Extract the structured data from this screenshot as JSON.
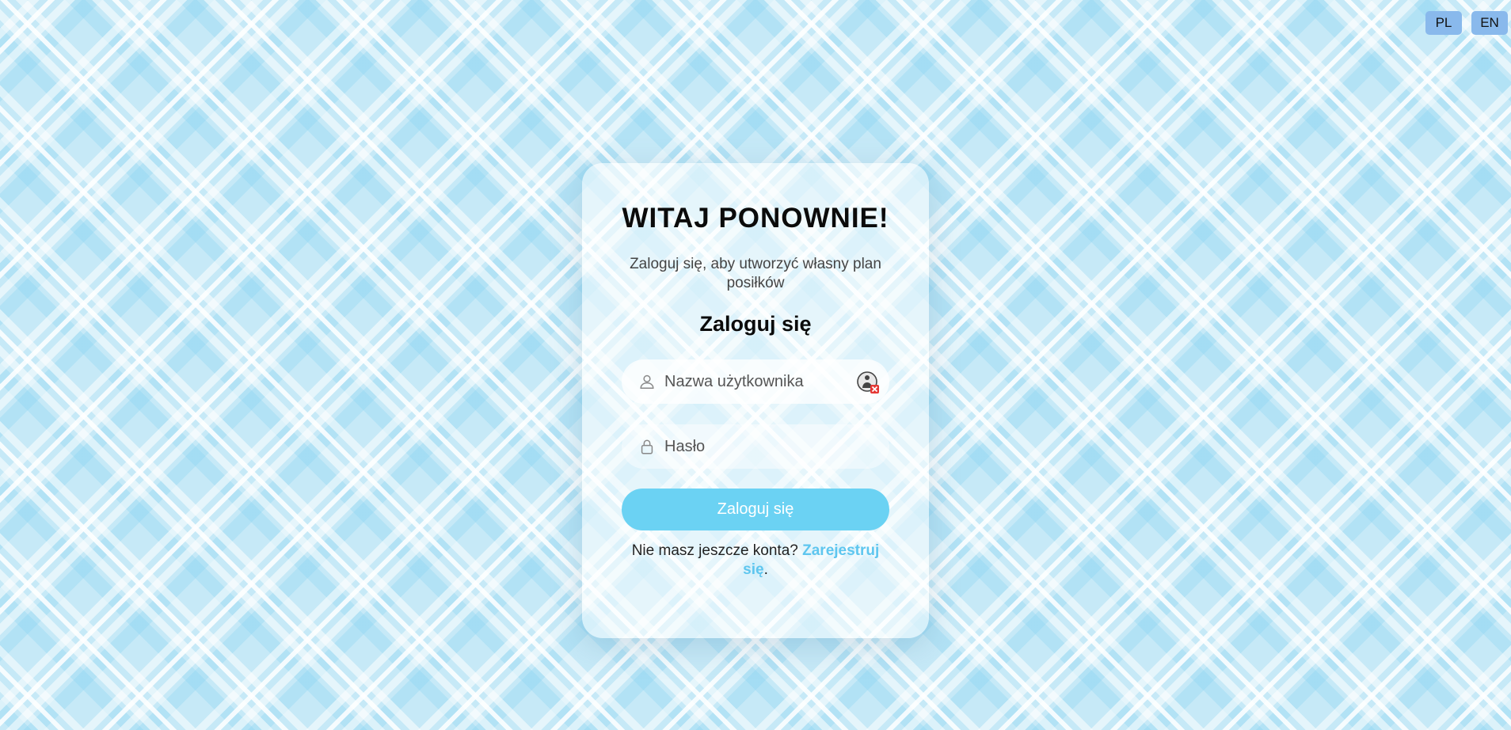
{
  "language_switch": {
    "options": [
      {
        "label": "PL"
      },
      {
        "label": "EN"
      }
    ]
  },
  "login_card": {
    "title": "WITAJ PONOWNIE!",
    "subtitle": "Zaloguj się, aby utworzyć własny plan posiłków",
    "form_heading": "Zaloguj się",
    "username": {
      "placeholder": "Nazwa użytkownika",
      "value": "",
      "icon": "user-icon"
    },
    "password": {
      "placeholder": "Hasło",
      "value": "",
      "icon": "lock-icon"
    },
    "submit_label": "Zaloguj się",
    "register_prompt": "Nie masz jeszcze konta?",
    "register_link": "Zarejestruj się",
    "register_suffix": "."
  },
  "colors": {
    "accent": "#6bd2f3",
    "link": "#5ec6ef",
    "lang_button": "#89b9ec",
    "background": "#c6e9f7"
  }
}
